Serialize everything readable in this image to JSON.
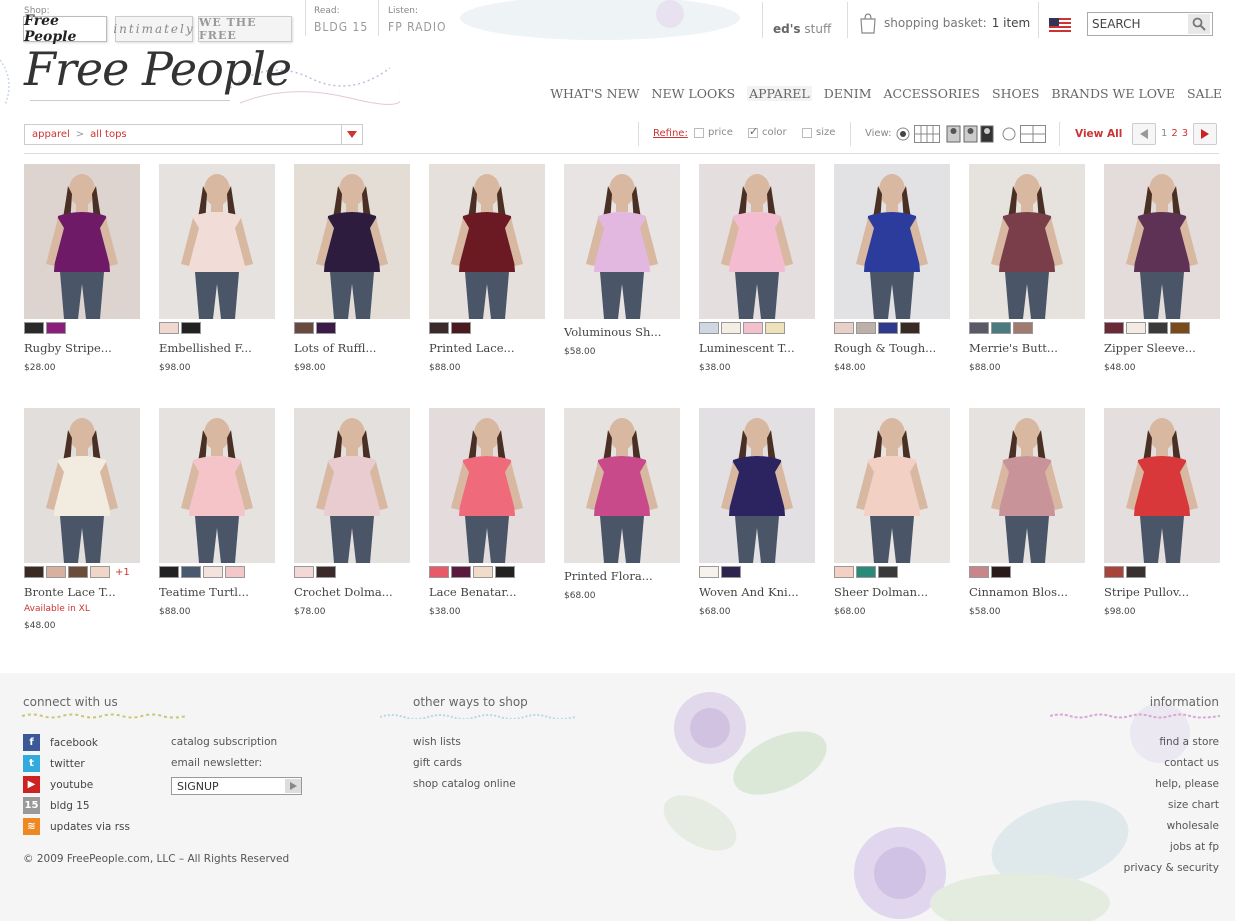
{
  "header": {
    "shop_label": "Shop:",
    "read_label": "Read:",
    "listen_label": "Listen:",
    "shop_tabs": [
      "Free People",
      "intimately",
      "WE THE FREE"
    ],
    "read_link": "BLDG 15",
    "listen_link": "FP RADIO",
    "logo": "Free People",
    "eds_stuff_bold": "ed's",
    "eds_stuff_rest": "stuff",
    "basket_label": "shopping basket:",
    "basket_count": "1 item",
    "search_placeholder": "SEARCH",
    "nav": [
      "WHAT'S NEW",
      "NEW LOOKS",
      "APPAREL",
      "DENIM",
      "ACCESSORIES",
      "SHOES",
      "BRANDS WE LOVE",
      "SALE"
    ],
    "nav_active": "APPAREL"
  },
  "toolbar": {
    "breadcrumb_1": "apparel",
    "breadcrumb_sep": ">",
    "breadcrumb_2": "all tops",
    "refine_label": "Refine:",
    "refine_price": "price",
    "refine_color": "color",
    "refine_size": "size",
    "view_label": "View:",
    "view_all": "View All",
    "pages": [
      "1",
      "2",
      "3"
    ],
    "current_page": "1"
  },
  "products": [
    {
      "name": "Rugby Stripe...",
      "price": "$28.00",
      "swatches": [
        "#2a2a2a",
        "#8a1e7a"
      ],
      "photo": {
        "bg": "#ddd4d0",
        "garment": "#6e1a66"
      }
    },
    {
      "name": "Embellished F...",
      "price": "$98.00",
      "swatches": [
        "#f2d6d0",
        "#222"
      ],
      "photo": {
        "bg": "#e6e2df",
        "garment": "#f2dcd8"
      }
    },
    {
      "name": "Lots of Ruffl...",
      "price": "$98.00",
      "swatches": [
        "#6a4a3e",
        "#3e1a4a"
      ],
      "photo": {
        "bg": "#e4ddd6",
        "garment": "#2d1c3d"
      }
    },
    {
      "name": "Printed Lace...",
      "price": "$88.00",
      "swatches": [
        "#3a2a2a",
        "#4a1a1e"
      ],
      "photo": {
        "bg": "#e6e0dc",
        "garment": "#6b1a24"
      }
    },
    {
      "name": "Voluminous Sh...",
      "price": "$58.00",
      "swatches": [],
      "photo": {
        "bg": "#e8e4e4",
        "garment": "#e2b8e0"
      }
    },
    {
      "name": "Luminescent T...",
      "price": "$38.00",
      "swatches": [
        "#cfd8e2",
        "#f4efe2",
        "#f4c0cc",
        "#efe2b8"
      ],
      "photo": {
        "bg": "#e4dede",
        "garment": "#f4bcd0"
      }
    },
    {
      "name": "Rough & Tough...",
      "price": "$48.00",
      "swatches": [
        "#e8d0c8",
        "#bdb0a8",
        "#2e3a8e",
        "#3a2a26"
      ],
      "photo": {
        "bg": "#e2e2e4",
        "garment": "#2c3c9c"
      }
    },
    {
      "name": "Merrie's Butt...",
      "price": "$88.00",
      "swatches": [
        "#5a5a66",
        "#4a7a80",
        "#a07a70"
      ],
      "photo": {
        "bg": "#e6e2de",
        "garment": "#7a3e4a"
      }
    },
    {
      "name": "Zipper Sleeve...",
      "price": "$48.00",
      "swatches": [
        "#6a2a36",
        "#f4ece2",
        "#3a3a3a",
        "#7a4a1a"
      ],
      "photo": {
        "bg": "#e4dcda",
        "garment": "#5e3254"
      }
    },
    {
      "name": "Bronte Lace T...",
      "avail": "Available in XL",
      "price": "$48.00",
      "swatches": [
        "#3a2a22",
        "#d8b0a0",
        "#6a4e3a",
        "#f0d6c8"
      ],
      "plus": "+1",
      "photo": {
        "bg": "#e2dedc",
        "garment": "#f2ece0"
      }
    },
    {
      "name": "Teatime Turtl...",
      "price": "$88.00",
      "swatches": [
        "#222",
        "#4a5a6e",
        "#f4e2de",
        "#f4c8c8"
      ],
      "photo": {
        "bg": "#e6e2e0",
        "garment": "#f4c4c8"
      }
    },
    {
      "name": "Crochet Dolma...",
      "price": "$78.00",
      "swatches": [
        "#f4d8d8",
        "#3a2a2a"
      ],
      "photo": {
        "bg": "#e4e0de",
        "garment": "#e8ccd0"
      }
    },
    {
      "name": "Lace Benatar...",
      "price": "$38.00",
      "swatches": [
        "#e85a6a",
        "#5a1a3e",
        "#f0dcc8",
        "#222"
      ],
      "photo": {
        "bg": "#e4dcdc",
        "garment": "#ef6a7a"
      }
    },
    {
      "name": "Printed Flora...",
      "price": "$68.00",
      "swatches": [],
      "photo": {
        "bg": "#e6e2e0",
        "garment": "#c84a8a"
      }
    },
    {
      "name": "Woven And Kni...",
      "price": "$68.00",
      "swatches": [
        "#f8f2ec",
        "#2e2450"
      ],
      "photo": {
        "bg": "#e2e0e2",
        "garment": "#2c2460"
      }
    },
    {
      "name": "Sheer Dolman...",
      "price": "$68.00",
      "swatches": [
        "#f4d0c4",
        "#2a8a7a",
        "#3a3a3a"
      ],
      "photo": {
        "bg": "#e8e4e2",
        "garment": "#f2d0c4"
      }
    },
    {
      "name": "Cinnamon Blos...",
      "price": "$58.00",
      "swatches": [
        "#c8868a",
        "#2a1a1a"
      ],
      "photo": {
        "bg": "#e6e2e0",
        "garment": "#c8949a"
      }
    },
    {
      "name": "Stripe Pullov...",
      "price": "$98.00",
      "swatches": [
        "#a8443a",
        "#3a3030"
      ],
      "photo": {
        "bg": "#e4dede",
        "garment": "#d8383a"
      }
    }
  ],
  "footer": {
    "connect_heading": "connect with us",
    "social": [
      {
        "label": "facebook",
        "icon": "facebook-icon",
        "color": "#3b5998",
        "glyph": "f"
      },
      {
        "label": "twitter",
        "icon": "twitter-icon",
        "color": "#33aadd",
        "glyph": "t"
      },
      {
        "label": "youtube",
        "icon": "youtube-icon",
        "color": "#cc2222",
        "glyph": "▶"
      },
      {
        "label": "bldg 15",
        "icon": "bldg15-icon",
        "color": "#999999",
        "glyph": "15"
      },
      {
        "label": "updates via rss",
        "icon": "rss-icon",
        "color": "#ee8822",
        "glyph": "≋"
      }
    ],
    "catalog_subscription": "catalog subscription",
    "email_newsletter": "email newsletter:",
    "signup_label": "SIGNUP",
    "other_heading": "other ways to shop",
    "other_links": [
      "wish lists",
      "gift cards",
      "shop catalog online"
    ],
    "info_heading": "information",
    "info_links": [
      "find a store",
      "contact us",
      "help, please",
      "size chart",
      "wholesale",
      "jobs at fp",
      "privacy & security"
    ],
    "copyright": "© 2009 FreePeople.com, LLC – All Rights Reserved"
  },
  "colors": {
    "accent": "#cc3333",
    "text": "#444444",
    "footer_bg": "#f5f5f5"
  }
}
